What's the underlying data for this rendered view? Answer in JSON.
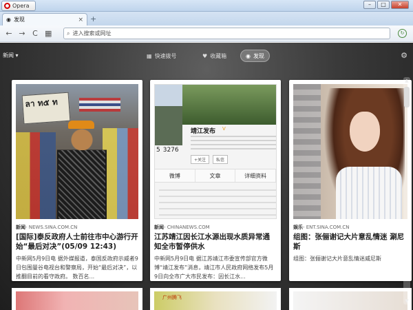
{
  "window": {
    "app_name": "Opera",
    "minimize": "–",
    "maximize": "□",
    "close": "✕"
  },
  "tab": {
    "title": "发现",
    "close": "×",
    "new": "+"
  },
  "toolbar": {
    "back": "←",
    "forward": "→",
    "reload": "C",
    "address_placeholder": "进入搜索或网址"
  },
  "discover": {
    "category": "新闻",
    "nav": [
      {
        "label": "快速拨号",
        "icon": "grid-icon"
      },
      {
        "label": "收藏箱",
        "icon": "heart-icon"
      },
      {
        "label": "发现",
        "icon": "eye-icon"
      }
    ]
  },
  "cards": [
    {
      "category": "新闻",
      "source": "- NEWS.SINA.COM.CN",
      "title": "[国际]泰反政府人士前往市中心游行开始“最后对决”(05/09 12:43)",
      "excerpt": "中新网5月9日电 据外媒报道，泰国反政府示威者9日包围曼谷电视台和警察局，开始“最后对决”，以推翻目前的看守政府。 数百名...",
      "sign_text": "ลา ท๕ ท"
    },
    {
      "category": "新闻",
      "source": "- CHINANEWS.COM",
      "title": "江苏靖江因长江水源出现水质异常通知全市暂停供水",
      "excerpt": "中新网5月9日电 据江苏靖江市委宣传部官方微博“靖江发布”消息，靖江市人民政府网络发布5月9日向全市广大市民发布：因长江水...",
      "weibo": {
        "name": "靖江发布",
        "stat1": "5",
        "stat2": "3276",
        "follow": "+关注",
        "message": "私信",
        "tabs": [
          "微博",
          "文章",
          "详细资料"
        ]
      }
    },
    {
      "category": "娱乐",
      "source": "- ENT.SINA.COM.CN",
      "title": "组图：张俪谢记大片意乱情迷 涮尼斯",
      "excerpt": "组图：张俪谢记大片意乱情迷威尼斯"
    }
  ],
  "bottom_card_2_label": "广州腾飞"
}
